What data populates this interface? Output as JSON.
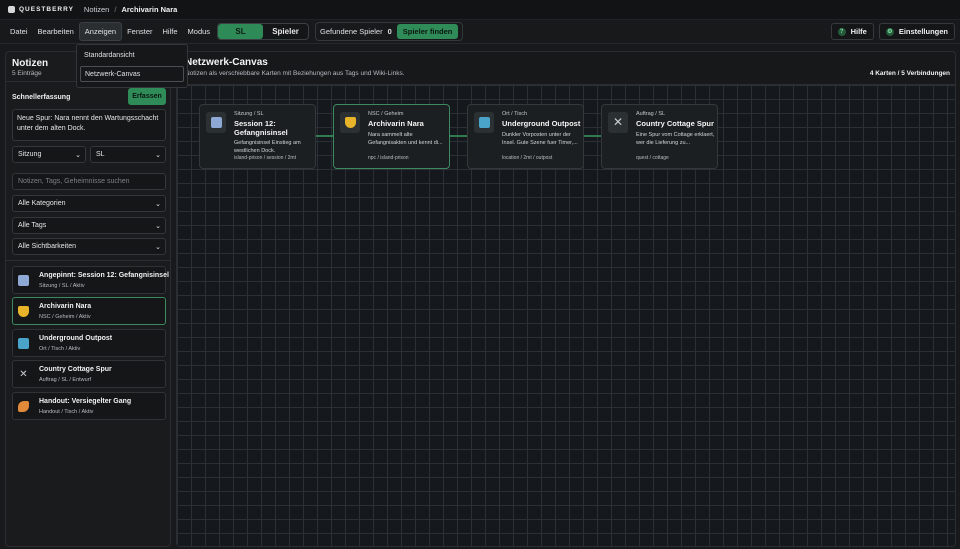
{
  "topbar": {
    "brand": "QUESTBERRY",
    "breadcrumb": [
      "Notizen",
      "Archivarin Nara"
    ]
  },
  "menu": {
    "items": [
      "Datei",
      "Bearbeiten",
      "Anzeigen",
      "Fenster",
      "Hilfe",
      "Modus"
    ],
    "mode_toggle": [
      "SL",
      "Spieler"
    ],
    "mode_active": "SL",
    "finder_label": "Gefundene Spieler",
    "finder_count": "0",
    "finder_button": "Spieler finden",
    "help_button": "Hilfe",
    "settings_button": "Einstellungen"
  },
  "view_menu": {
    "options": [
      "Standardansicht",
      "Netzwerk-Canvas"
    ],
    "selected": "Netzwerk-Canvas"
  },
  "notes_panel": {
    "title": "Notizen",
    "count_text": "5 Einträge",
    "quick_capture_label": "Schnellerfassung",
    "capture_button": "Erfassen",
    "quick_text": "Neue Spur: Nara nennt den Wartungsschacht unter dem alten Dock.",
    "type_select": "Sitzung",
    "visibility_select": "SL",
    "search_placeholder": "Notizen, Tags, Geheimnisse suchen",
    "filter_category": "Alle Kategorien",
    "filter_tags": "Alle Tags",
    "filter_visibility": "Alle Sichtbarkeiten",
    "notes": [
      {
        "title": "Angepinnt: Session 12: Gefangnisinsel",
        "meta": "Sitzung / SL / Aktiv",
        "icon": "calendar-icon",
        "color": "#8fa9d6"
      },
      {
        "title": "Archivarin Nara",
        "meta": "NSC / Geheim / Aktiv",
        "icon": "shield-icon",
        "color": "#e8b42a"
      },
      {
        "title": "Underground Outpost",
        "meta": "Ort / Tisch / Aktiv",
        "icon": "map-icon",
        "color": "#4aa3c9"
      },
      {
        "title": "Country Cottage Spur",
        "meta": "Auftrag / SL / Entwurf",
        "icon": "crossed-swords-icon",
        "color": "#c9ced3"
      },
      {
        "title": "Handout: Versiegelter Gang",
        "meta": "Handout / Tisch / Aktiv",
        "icon": "scroll-icon",
        "color": "#e08a3a"
      }
    ]
  },
  "canvas": {
    "title": "Netzwerk-Canvas",
    "description": "Notizen als verschiebbare Karten mit Beziehungen aus Tags und Wiki-Links.",
    "count": "4 Karten / 5 Verbindungen",
    "cards": [
      {
        "kind": "Sitzung / SL",
        "title": "Session 12: Gefangnisinsel",
        "body": "Gefangnisinsel Einstieg am westlichen Dock.",
        "tags": "island-prison / session / 2mt",
        "icon": "calendar-icon",
        "color": "#8fa9d6"
      },
      {
        "kind": "NSC / Geheim",
        "title": "Archivarin Nara",
        "body": "Nara sammelt alte Gefangnisakten und kennt di...",
        "tags": "npc / island-prison",
        "icon": "shield-icon",
        "color": "#e8b42a"
      },
      {
        "kind": "Ort / Tisch",
        "title": "Underground Outpost",
        "body": "Dunkler Vorposten unter der Insel. Gute Szene fuer Timer,...",
        "tags": "location / 2mt / outpost",
        "icon": "map-icon",
        "color": "#4aa3c9"
      },
      {
        "kind": "Auftrag / SL",
        "title": "Country Cottage Spur",
        "body": "Eine Spur vom Cottage erklaert, wer die Lieferung zu...",
        "tags": "quest / cottage",
        "icon": "crossed-swords-icon",
        "color": "#c9ced3"
      }
    ]
  }
}
